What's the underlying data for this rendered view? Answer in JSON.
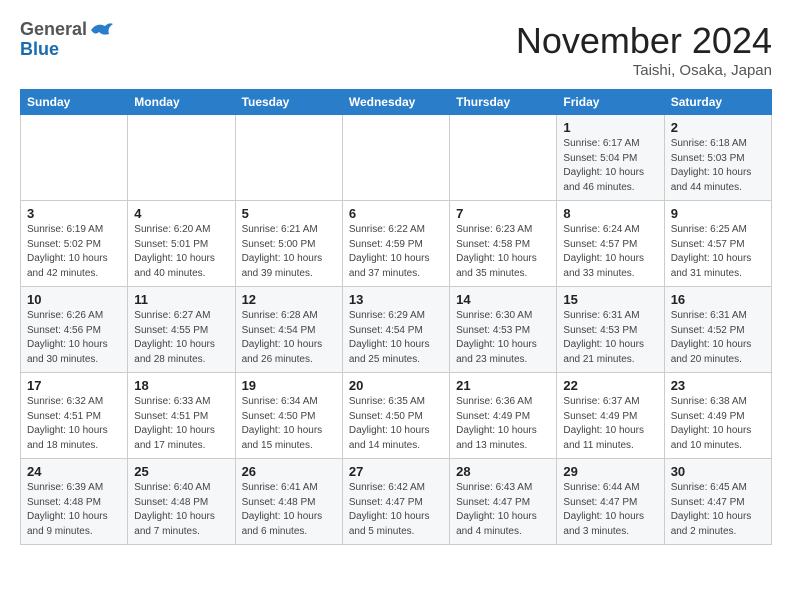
{
  "header": {
    "logo_general": "General",
    "logo_blue": "Blue",
    "month_title": "November 2024",
    "location": "Taishi, Osaka, Japan"
  },
  "calendar": {
    "days_of_week": [
      "Sunday",
      "Monday",
      "Tuesday",
      "Wednesday",
      "Thursday",
      "Friday",
      "Saturday"
    ],
    "weeks": [
      [
        {
          "day": "",
          "info": ""
        },
        {
          "day": "",
          "info": ""
        },
        {
          "day": "",
          "info": ""
        },
        {
          "day": "",
          "info": ""
        },
        {
          "day": "",
          "info": ""
        },
        {
          "day": "1",
          "info": "Sunrise: 6:17 AM\nSunset: 5:04 PM\nDaylight: 10 hours\nand 46 minutes."
        },
        {
          "day": "2",
          "info": "Sunrise: 6:18 AM\nSunset: 5:03 PM\nDaylight: 10 hours\nand 44 minutes."
        }
      ],
      [
        {
          "day": "3",
          "info": "Sunrise: 6:19 AM\nSunset: 5:02 PM\nDaylight: 10 hours\nand 42 minutes."
        },
        {
          "day": "4",
          "info": "Sunrise: 6:20 AM\nSunset: 5:01 PM\nDaylight: 10 hours\nand 40 minutes."
        },
        {
          "day": "5",
          "info": "Sunrise: 6:21 AM\nSunset: 5:00 PM\nDaylight: 10 hours\nand 39 minutes."
        },
        {
          "day": "6",
          "info": "Sunrise: 6:22 AM\nSunset: 4:59 PM\nDaylight: 10 hours\nand 37 minutes."
        },
        {
          "day": "7",
          "info": "Sunrise: 6:23 AM\nSunset: 4:58 PM\nDaylight: 10 hours\nand 35 minutes."
        },
        {
          "day": "8",
          "info": "Sunrise: 6:24 AM\nSunset: 4:57 PM\nDaylight: 10 hours\nand 33 minutes."
        },
        {
          "day": "9",
          "info": "Sunrise: 6:25 AM\nSunset: 4:57 PM\nDaylight: 10 hours\nand 31 minutes."
        }
      ],
      [
        {
          "day": "10",
          "info": "Sunrise: 6:26 AM\nSunset: 4:56 PM\nDaylight: 10 hours\nand 30 minutes."
        },
        {
          "day": "11",
          "info": "Sunrise: 6:27 AM\nSunset: 4:55 PM\nDaylight: 10 hours\nand 28 minutes."
        },
        {
          "day": "12",
          "info": "Sunrise: 6:28 AM\nSunset: 4:54 PM\nDaylight: 10 hours\nand 26 minutes."
        },
        {
          "day": "13",
          "info": "Sunrise: 6:29 AM\nSunset: 4:54 PM\nDaylight: 10 hours\nand 25 minutes."
        },
        {
          "day": "14",
          "info": "Sunrise: 6:30 AM\nSunset: 4:53 PM\nDaylight: 10 hours\nand 23 minutes."
        },
        {
          "day": "15",
          "info": "Sunrise: 6:31 AM\nSunset: 4:53 PM\nDaylight: 10 hours\nand 21 minutes."
        },
        {
          "day": "16",
          "info": "Sunrise: 6:31 AM\nSunset: 4:52 PM\nDaylight: 10 hours\nand 20 minutes."
        }
      ],
      [
        {
          "day": "17",
          "info": "Sunrise: 6:32 AM\nSunset: 4:51 PM\nDaylight: 10 hours\nand 18 minutes."
        },
        {
          "day": "18",
          "info": "Sunrise: 6:33 AM\nSunset: 4:51 PM\nDaylight: 10 hours\nand 17 minutes."
        },
        {
          "day": "19",
          "info": "Sunrise: 6:34 AM\nSunset: 4:50 PM\nDaylight: 10 hours\nand 15 minutes."
        },
        {
          "day": "20",
          "info": "Sunrise: 6:35 AM\nSunset: 4:50 PM\nDaylight: 10 hours\nand 14 minutes."
        },
        {
          "day": "21",
          "info": "Sunrise: 6:36 AM\nSunset: 4:49 PM\nDaylight: 10 hours\nand 13 minutes."
        },
        {
          "day": "22",
          "info": "Sunrise: 6:37 AM\nSunset: 4:49 PM\nDaylight: 10 hours\nand 11 minutes."
        },
        {
          "day": "23",
          "info": "Sunrise: 6:38 AM\nSunset: 4:49 PM\nDaylight: 10 hours\nand 10 minutes."
        }
      ],
      [
        {
          "day": "24",
          "info": "Sunrise: 6:39 AM\nSunset: 4:48 PM\nDaylight: 10 hours\nand 9 minutes."
        },
        {
          "day": "25",
          "info": "Sunrise: 6:40 AM\nSunset: 4:48 PM\nDaylight: 10 hours\nand 7 minutes."
        },
        {
          "day": "26",
          "info": "Sunrise: 6:41 AM\nSunset: 4:48 PM\nDaylight: 10 hours\nand 6 minutes."
        },
        {
          "day": "27",
          "info": "Sunrise: 6:42 AM\nSunset: 4:47 PM\nDaylight: 10 hours\nand 5 minutes."
        },
        {
          "day": "28",
          "info": "Sunrise: 6:43 AM\nSunset: 4:47 PM\nDaylight: 10 hours\nand 4 minutes."
        },
        {
          "day": "29",
          "info": "Sunrise: 6:44 AM\nSunset: 4:47 PM\nDaylight: 10 hours\nand 3 minutes."
        },
        {
          "day": "30",
          "info": "Sunrise: 6:45 AM\nSunset: 4:47 PM\nDaylight: 10 hours\nand 2 minutes."
        }
      ]
    ]
  }
}
